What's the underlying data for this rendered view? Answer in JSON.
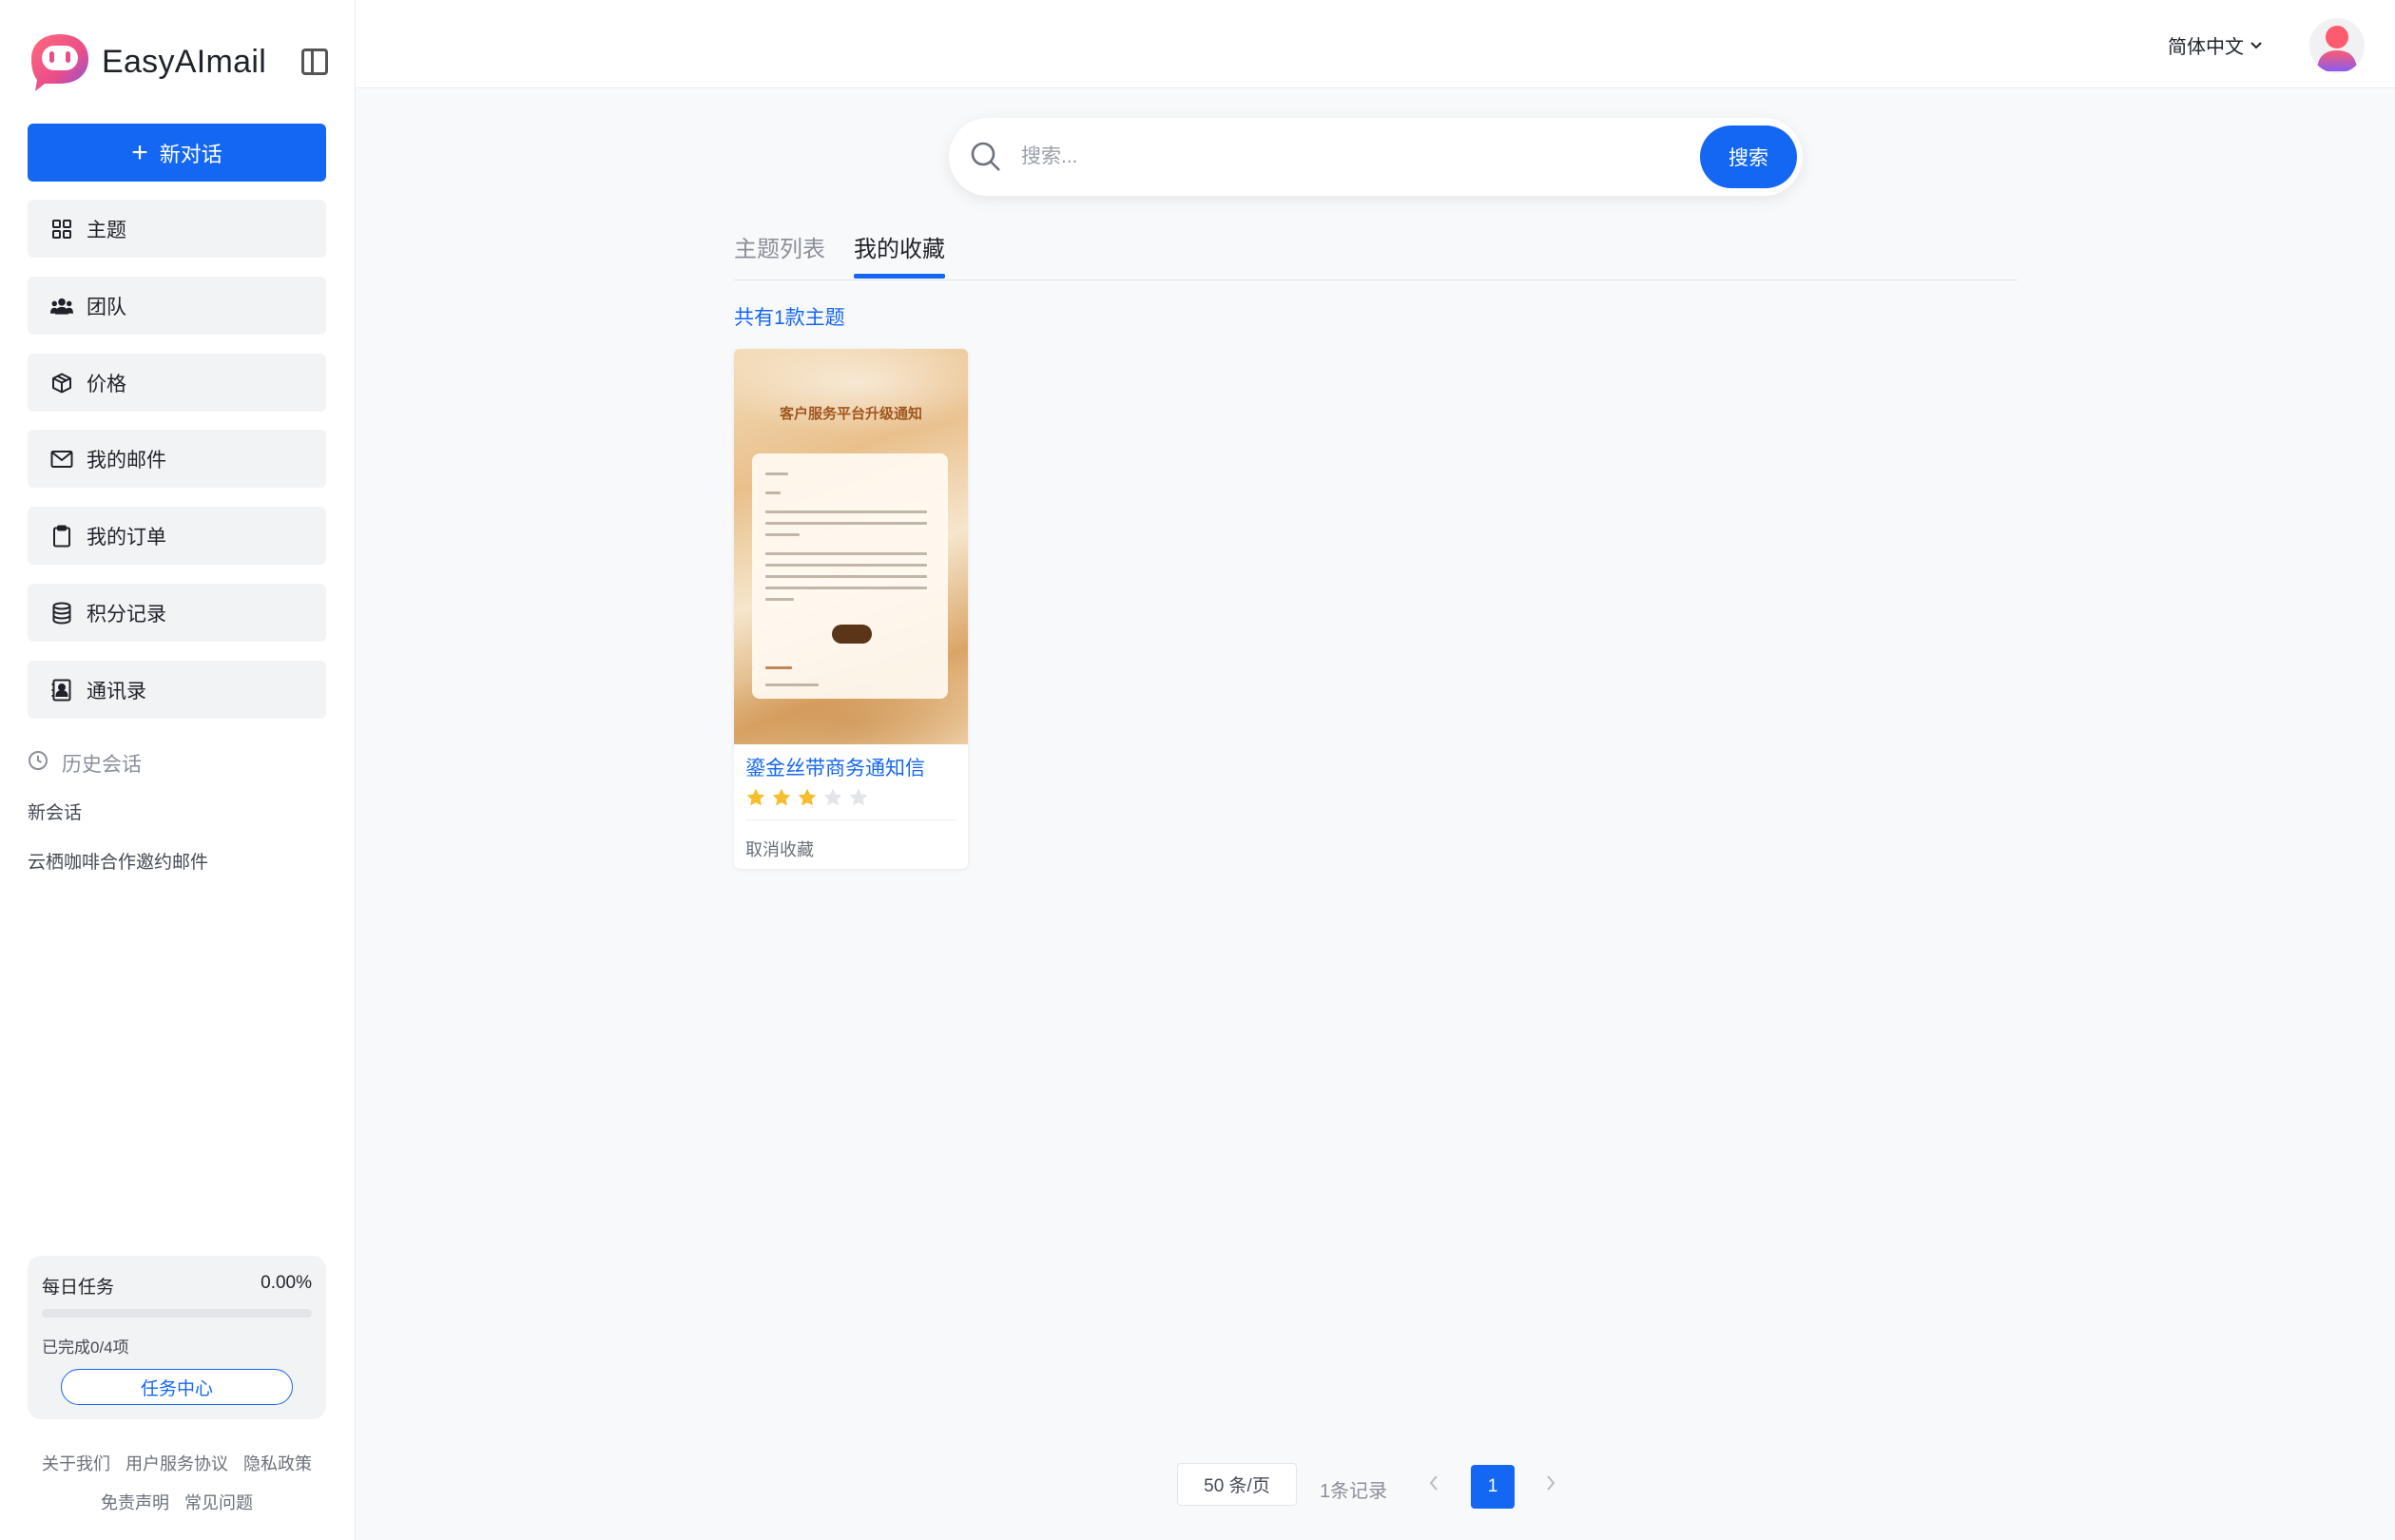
{
  "app": {
    "name": "EasyAImail",
    "colors": {
      "accent": "#1467f2",
      "sidebar_bg": "#ffffff",
      "page_bg": "#f8f9fa",
      "star_filled": "#f5be2e",
      "star_empty": "#e3e5e8"
    }
  },
  "sidebar": {
    "new_chat_label": "新对话",
    "items": [
      {
        "label": "主题",
        "icon": "grid-icon"
      },
      {
        "label": "团队",
        "icon": "users-icon"
      },
      {
        "label": "价格",
        "icon": "box-icon"
      },
      {
        "label": "我的邮件",
        "icon": "mail-icon"
      },
      {
        "label": "我的订单",
        "icon": "clipboard-icon"
      },
      {
        "label": "积分记录",
        "icon": "database-icon"
      },
      {
        "label": "通讯录",
        "icon": "contact-book-icon"
      }
    ],
    "history_title": "历史会话",
    "history": [
      "新会话",
      "云栖咖啡合作邀约邮件"
    ],
    "task": {
      "title": "每日任务",
      "percent_text": "0.00%",
      "progress": 0,
      "done_text": "已完成0/4项",
      "center_label": "任务中心"
    },
    "footer_row1": [
      "关于我们",
      "用户服务协议",
      "隐私政策"
    ],
    "footer_row2": [
      "免责声明",
      "常见问题"
    ]
  },
  "header": {
    "language": "简体中文"
  },
  "search": {
    "placeholder": "搜索...",
    "button_label": "搜索"
  },
  "tabs": [
    {
      "label": "主题列表",
      "active": false
    },
    {
      "label": "我的收藏",
      "active": true
    }
  ],
  "count_label": "共有1款主题",
  "themes": [
    {
      "name": "鎏金丝带商务通知信",
      "rating": 3,
      "max_rating": 5,
      "action_label": "取消收藏",
      "thumbnail": {
        "title": "客户服务平台升级通知"
      }
    }
  ],
  "pagination": {
    "page_size_label": "50 条/页",
    "total_label": "1条记录",
    "current_page": "1"
  }
}
